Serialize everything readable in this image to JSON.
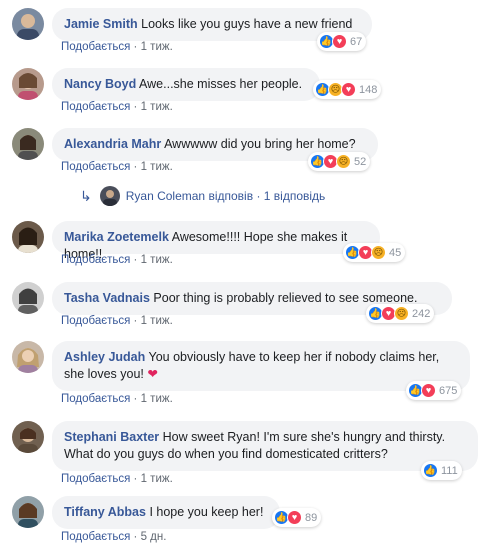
{
  "colors": {
    "name": "#385898",
    "bubble": "#f2f3f5",
    "meta": "#606770",
    "like": "#1877f2",
    "love": "#f33e58",
    "sad": "#f7b125"
  },
  "comments": [
    {
      "name": "Jamie Smith",
      "text": "Looks like you guys have a new friend",
      "like_label": "Подобається",
      "time": "1 тиж.",
      "reactions": [
        "like-icon",
        "love-icon"
      ],
      "count": "67"
    },
    {
      "name": "Nancy Boyd",
      "text": "Awe...she misses her people.",
      "like_label": "Подобається",
      "time": "1 тиж.",
      "reactions": [
        "like-icon",
        "sad-icon",
        "love-icon"
      ],
      "count": "148"
    },
    {
      "name": "Alexandria Mahr",
      "text": "Awwwww did you bring her home?",
      "like_label": "Подобається",
      "time": "1 тиж.",
      "reactions": [
        "like-icon",
        "love-icon",
        "sad-icon"
      ],
      "count": "52"
    },
    {
      "name": "Marika Zoetemelk",
      "text": "Awesome!!!! Hope she makes it home!!",
      "like_label": "Подобається",
      "time": "1 тиж.",
      "reactions": [
        "like-icon",
        "love-icon",
        "sad-icon"
      ],
      "count": "45"
    },
    {
      "name": "Tasha Vadnais",
      "text": "Poor thing is probably relieved to see someone.",
      "like_label": "Подобається",
      "time": "1 тиж.",
      "reactions": [
        "like-icon",
        "love-icon",
        "sad-icon"
      ],
      "count": "242"
    },
    {
      "name": "Ashley Judah",
      "text": "You obviously have to keep her if nobody claims her, she loves you!",
      "like_label": "Подобається",
      "time": "1 тиж.",
      "reactions": [
        "like-icon",
        "love-icon"
      ],
      "count": "675"
    },
    {
      "name": "Stephani Baxter",
      "text": "How sweet Ryan! I'm sure she's hungry and thirsty. What do you guys do when you find domesticated critters?",
      "like_label": "Подобається",
      "time": "1 тиж.",
      "reactions": [
        "like-icon"
      ],
      "count": "111"
    },
    {
      "name": "Tiffany Abbas",
      "text": "I hope you keep her!",
      "like_label": "Подобається",
      "time": "5 дн.",
      "reactions": [
        "like-icon",
        "love-icon"
      ],
      "count": "89"
    }
  ],
  "reply": {
    "author": "Ryan Coleman",
    "verb": "відповів",
    "sep": "·",
    "count_label": "1 відповідь"
  },
  "separator": "·",
  "heart_emoji": "❤"
}
